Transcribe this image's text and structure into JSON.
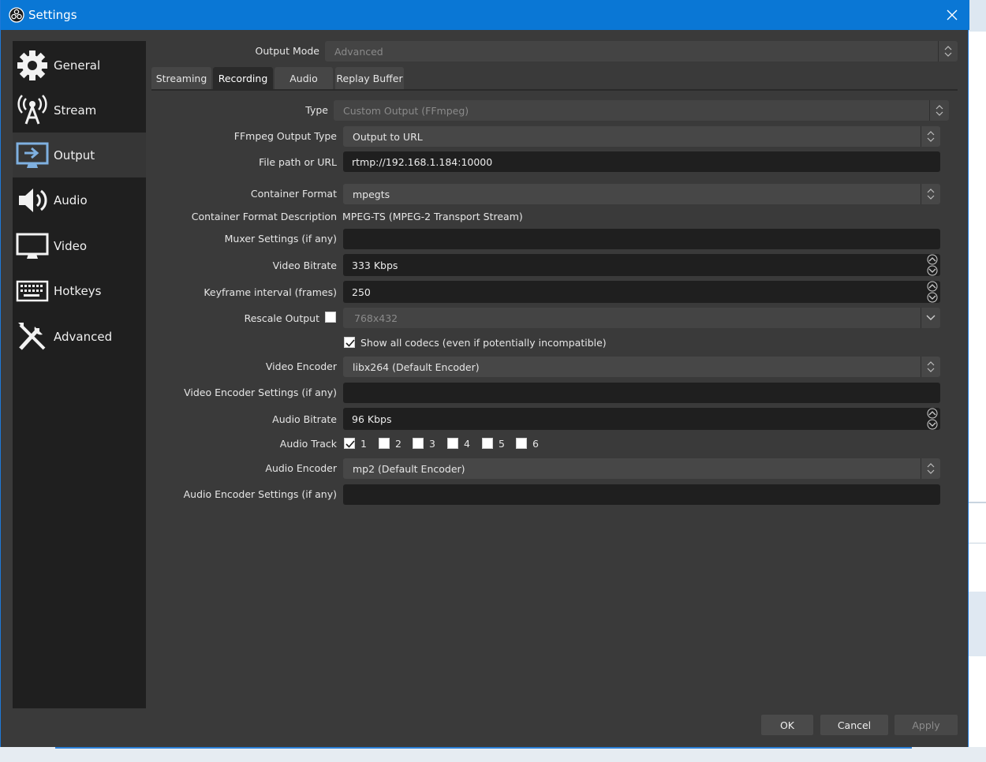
{
  "window": {
    "title": "Settings"
  },
  "sidebar": {
    "items": [
      {
        "label": "General",
        "icon": "gear-icon"
      },
      {
        "label": "Stream",
        "icon": "broadcast-tower-icon"
      },
      {
        "label": "Output",
        "icon": "monitor-output-icon",
        "active": true
      },
      {
        "label": "Audio",
        "icon": "speaker-icon"
      },
      {
        "label": "Video",
        "icon": "monitor-icon"
      },
      {
        "label": "Hotkeys",
        "icon": "keyboard-icon"
      },
      {
        "label": "Advanced",
        "icon": "tools-icon"
      }
    ]
  },
  "output_mode": {
    "label": "Output Mode",
    "value": "Advanced"
  },
  "tabs": [
    {
      "label": "Streaming"
    },
    {
      "label": "Recording",
      "active": true
    },
    {
      "label": "Audio"
    },
    {
      "label": "Replay Buffer"
    }
  ],
  "recording": {
    "type": {
      "label": "Type",
      "value": "Custom Output (FFmpeg)"
    },
    "ffmpeg_output_type": {
      "label": "FFmpeg Output Type",
      "value": "Output to URL"
    },
    "file_path": {
      "label": "File path or URL",
      "value": "rtmp://192.168.1.184:10000"
    },
    "container_format": {
      "label": "Container Format",
      "value": "mpegts"
    },
    "container_desc": {
      "label": "Container Format Description",
      "value": "MPEG-TS (MPEG-2 Transport Stream)"
    },
    "muxer_settings": {
      "label": "Muxer Settings (if any)",
      "value": ""
    },
    "video_bitrate": {
      "label": "Video Bitrate",
      "value": "333 Kbps"
    },
    "keyframe_interval": {
      "label": "Keyframe interval (frames)",
      "value": "250"
    },
    "rescale_output": {
      "label": "Rescale Output",
      "checked": false,
      "value": "768x432"
    },
    "show_all_codecs": {
      "label": "Show all codecs (even if potentially incompatible)",
      "checked": true
    },
    "video_encoder": {
      "label": "Video Encoder",
      "value": "libx264 (Default Encoder)"
    },
    "video_encoder_settings": {
      "label": "Video Encoder Settings (if any)",
      "value": ""
    },
    "audio_bitrate": {
      "label": "Audio Bitrate",
      "value": "96 Kbps"
    },
    "audio_track": {
      "label": "Audio Track",
      "tracks": [
        {
          "label": "1",
          "checked": true
        },
        {
          "label": "2",
          "checked": false
        },
        {
          "label": "3",
          "checked": false
        },
        {
          "label": "4",
          "checked": false
        },
        {
          "label": "5",
          "checked": false
        },
        {
          "label": "6",
          "checked": false
        }
      ]
    },
    "audio_encoder": {
      "label": "Audio Encoder",
      "value": "mp2 (Default Encoder)"
    },
    "audio_encoder_settings": {
      "label": "Audio Encoder Settings (if any)",
      "value": ""
    }
  },
  "buttons": {
    "ok": "OK",
    "cancel": "Cancel",
    "apply": "Apply"
  },
  "colors": {
    "titlebar": "#0a77d5",
    "background": "#3a3a3a",
    "sidebar": "#1f1f1f",
    "field": "#1f1f1f"
  }
}
